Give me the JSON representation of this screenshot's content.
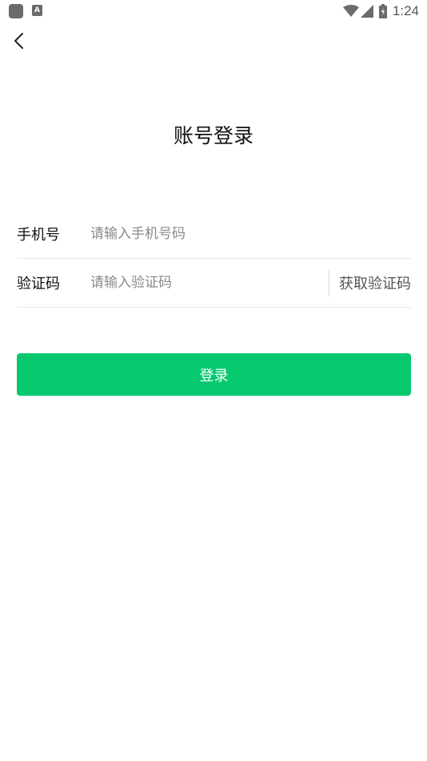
{
  "status_bar": {
    "time": "1:24",
    "left_icon_2_letter": "A",
    "icons": [
      "app-icon",
      "a-icon",
      "wifi-icon",
      "signal-icon",
      "battery-icon"
    ]
  },
  "header": {
    "back_icon": "chevron-left-icon",
    "title": "账号登录"
  },
  "form": {
    "phone": {
      "label": "手机号",
      "placeholder": "请输入手机号码",
      "value": ""
    },
    "code": {
      "label": "验证码",
      "placeholder": "请输入验证码",
      "value": "",
      "get_code_label": "获取验证码"
    }
  },
  "login_button": {
    "label": "登录",
    "color": "#06c96f"
  }
}
